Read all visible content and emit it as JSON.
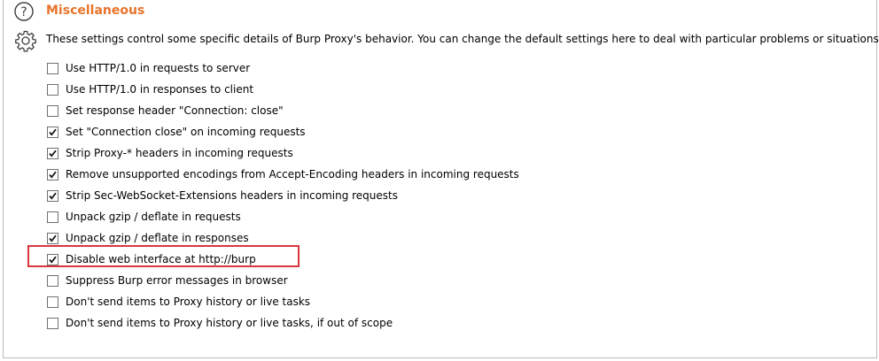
{
  "section": {
    "title": "Miscellaneous",
    "description": "These settings control some specific details of Burp Proxy's behavior. You can change the default settings here to deal with particular problems or situations.",
    "help_icon": "help-icon",
    "settings_icon": "gear-icon"
  },
  "colors": {
    "title": "#e8742a",
    "highlight": "#d9363e"
  },
  "options": [
    {
      "label": "Use HTTP/1.0 in requests to server",
      "checked": false
    },
    {
      "label": "Use HTTP/1.0 in responses to client",
      "checked": false
    },
    {
      "label": "Set response header \"Connection: close\"",
      "checked": false
    },
    {
      "label": "Set \"Connection close\" on incoming requests",
      "checked": true
    },
    {
      "label": "Strip Proxy-* headers in incoming requests",
      "checked": true
    },
    {
      "label": "Remove unsupported encodings from Accept-Encoding headers in incoming requests",
      "checked": true
    },
    {
      "label": "Strip Sec-WebSocket-Extensions headers in incoming requests",
      "checked": true
    },
    {
      "label": "Unpack gzip / deflate in requests",
      "checked": false
    },
    {
      "label": "Unpack gzip / deflate in responses",
      "checked": true
    },
    {
      "label": "Disable web interface at http://burp",
      "checked": true
    },
    {
      "label": "Suppress Burp error messages in browser",
      "checked": false
    },
    {
      "label": "Don't send items to Proxy history or live tasks",
      "checked": false
    },
    {
      "label": "Don't send items to Proxy history or live tasks, if out of scope",
      "checked": false
    }
  ]
}
